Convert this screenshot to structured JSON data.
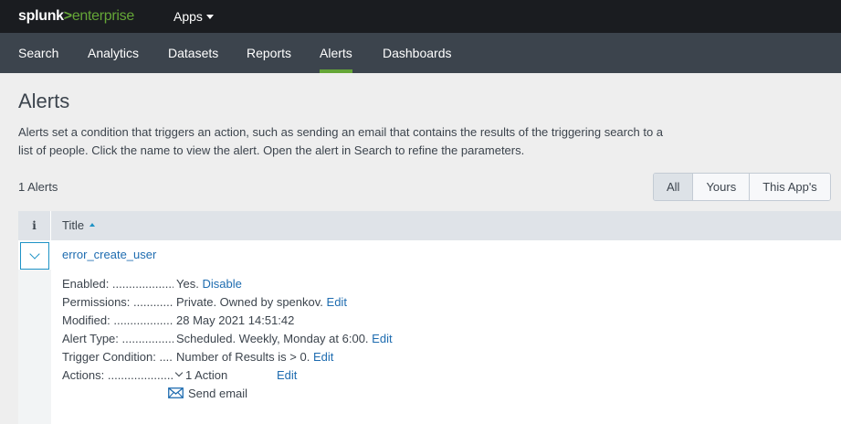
{
  "header": {
    "brand_part1": "splunk",
    "brand_part2": ">",
    "brand_part3": "enterprise",
    "apps_label": "Apps"
  },
  "nav": {
    "items": [
      {
        "label": "Search"
      },
      {
        "label": "Analytics"
      },
      {
        "label": "Datasets"
      },
      {
        "label": "Reports"
      },
      {
        "label": "Alerts",
        "active": true
      },
      {
        "label": "Dashboards"
      }
    ]
  },
  "page": {
    "title": "Alerts",
    "description": "Alerts set a condition that triggers an action, such as sending an email that contains the results of the triggering search to a list of people. Click the name to view the alert. Open the alert in Search to refine the parameters.",
    "count_label": "1 Alerts"
  },
  "filters": {
    "all": "All",
    "yours": "Yours",
    "this_app": "This App's",
    "selected": "All"
  },
  "table": {
    "info_header": "i",
    "title_header": "Title",
    "row": {
      "title": "error_create_user",
      "details": {
        "enabled_label": "Enabled: .......................................",
        "enabled_value": "Yes.",
        "enabled_action": "Disable",
        "permissions_label": "Permissions: ................................",
        "permissions_value": "Private. Owned by spenkov.",
        "permissions_action": "Edit",
        "modified_label": "Modified: .......................................",
        "modified_value": "28 May 2021 14:51:42",
        "alert_type_label": "Alert Type: ....................................",
        "alert_type_value": "Scheduled. Weekly, Monday at 6:00.",
        "alert_type_action": "Edit",
        "trigger_label": "Trigger Condition: .........................",
        "trigger_value": "Number of Results is > 0.",
        "trigger_action": "Edit",
        "actions_label": "Actions: ..........................................",
        "actions_value": "1 Action",
        "actions_action": "Edit",
        "action_item": "Send email"
      }
    }
  },
  "colors": {
    "accent_green": "#65a637",
    "link_blue": "#1e6cb0",
    "topbar": "#1a1c20",
    "appnav": "#3c444d"
  }
}
